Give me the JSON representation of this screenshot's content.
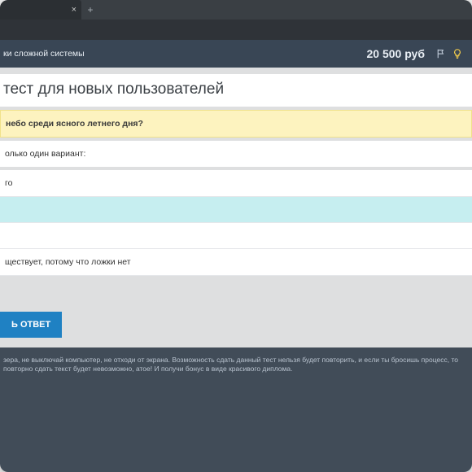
{
  "browser": {
    "tab_title": "",
    "close_glyph": "×",
    "new_tab_glyph": "+"
  },
  "header": {
    "breadcrumb": "ки сложной системы",
    "balance": "20 500 руб"
  },
  "page": {
    "title": "тест для новых пользователей"
  },
  "question": {
    "text": "небо среди ясного летнего дня?"
  },
  "prompt": "олько один вариант:",
  "answers": [
    {
      "label": "го",
      "selected": false
    },
    {
      "label": "",
      "selected": true
    },
    {
      "label": "",
      "selected": false
    },
    {
      "label": "ществует, потому что ложки нет",
      "selected": false
    }
  ],
  "submit_label": "Ь ОТВЕТ",
  "footer_text": "зера, не выключай компьютер, не отходи от экрана. Возможность сдать данный тест нельзя будет повторить, и если ты бросишь процесс, то повторно сдать текст будет невозможно, атое! И получи бонус в виде красивого диплома."
}
